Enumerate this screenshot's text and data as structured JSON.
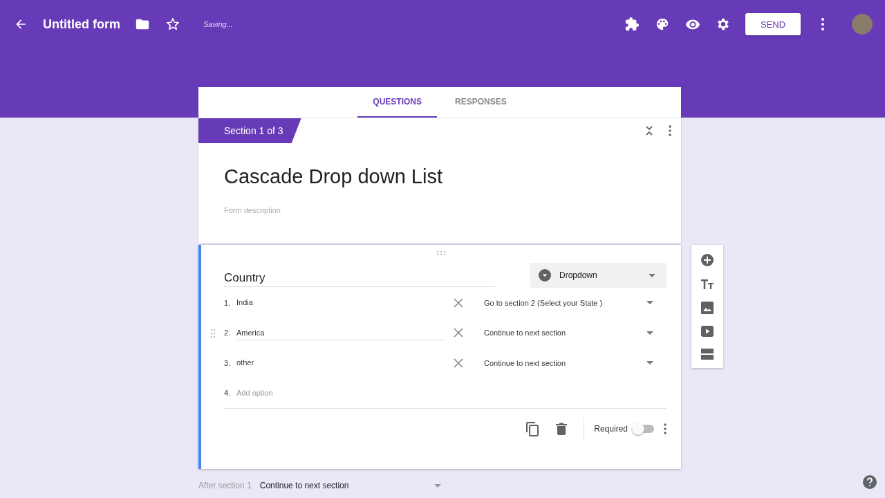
{
  "header": {
    "title": "Untitled form",
    "status": "Saving...",
    "send_button": "SEND"
  },
  "tabs": [
    {
      "label": "QUESTIONS",
      "selected": true
    },
    {
      "label": "RESPONSES",
      "selected": false
    }
  ],
  "section": {
    "label": "Section 1 of 3",
    "title": "Cascade Drop down List",
    "description_placeholder": "Form description"
  },
  "question": {
    "title": "Country",
    "type": "Dropdown",
    "options": [
      {
        "number": "1.",
        "label": "India",
        "destination": "Go to section 2 (Select your State )",
        "focused": false
      },
      {
        "number": "2.",
        "label": "America",
        "destination": "Continue to next section",
        "focused": true
      },
      {
        "number": "3.",
        "label": "other",
        "destination": "Continue to next section",
        "focused": false
      }
    ],
    "add_option": {
      "number": "4.",
      "placeholder": "Add option"
    },
    "required_label": "Required",
    "required": false
  },
  "after_section": {
    "label": "After section 1",
    "value": "Continue to next section"
  }
}
